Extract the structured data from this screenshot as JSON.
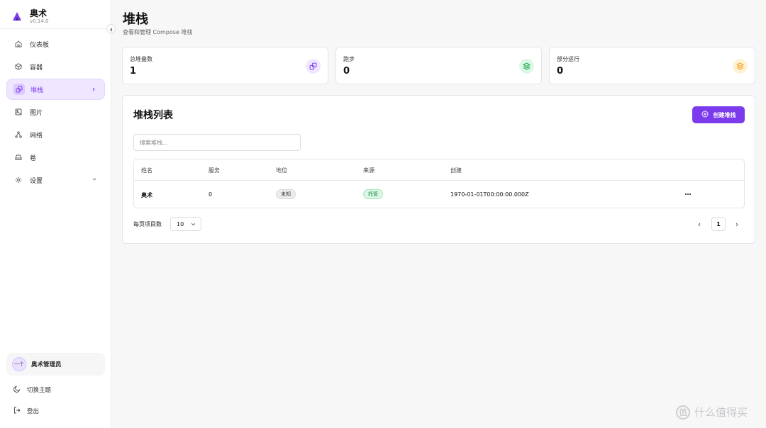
{
  "brand": {
    "name": "奥术",
    "version": "v0.14.0"
  },
  "sidebar": {
    "items": [
      {
        "label": "仪表板",
        "icon": "home-icon"
      },
      {
        "label": "容器",
        "icon": "box-icon"
      },
      {
        "label": "堆栈",
        "icon": "stack-icon",
        "active": true
      },
      {
        "label": "图片",
        "icon": "image-icon"
      },
      {
        "label": "网络",
        "icon": "network-icon"
      },
      {
        "label": "卷",
        "icon": "drive-icon"
      },
      {
        "label": "设置",
        "icon": "gear-icon"
      }
    ],
    "user": {
      "avatar_text": "一个",
      "name": "奥术管理员"
    },
    "footer": {
      "theme_label": "切换主题",
      "logout_label": "登出"
    }
  },
  "header": {
    "title": "堆栈",
    "subtitle": "查看和管理 Compose 堆栈"
  },
  "stats": [
    {
      "label": "总堆叠数",
      "value": "1",
      "icon": "stack-icon",
      "color": "#7c3aed"
    },
    {
      "label": "跑步",
      "value": "0",
      "icon": "layers-icon",
      "color": "#16a34a"
    },
    {
      "label": "部分运行",
      "value": "0",
      "icon": "layers-icon",
      "color": "#f59e0b"
    }
  ],
  "list": {
    "title": "堆栈列表",
    "create_label": "创建堆栈",
    "search_placeholder": "搜索堆栈...",
    "columns": [
      "姓名",
      "服务",
      "地位",
      "来源",
      "创建"
    ],
    "rows": [
      {
        "name": "奥术",
        "services": "0",
        "status": "未知",
        "source": "托管",
        "created": "1970-01-01T00:00:00.000Z"
      }
    ],
    "per_page_label": "每页项目数",
    "per_page_value": "10",
    "current_page": "1"
  },
  "colors": {
    "accent": "#7c3aed",
    "success": "#16a34a",
    "warning": "#f59e0b"
  },
  "watermark": {
    "text": "什么值得买",
    "logo_text": "值"
  }
}
